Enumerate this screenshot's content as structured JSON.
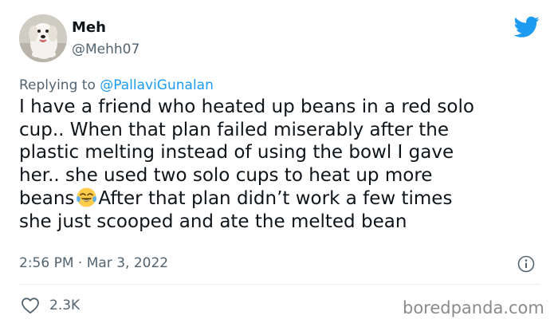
{
  "user": {
    "display_name": "Meh",
    "handle": "@Mehh07",
    "avatar_alt": "white puppy avatar"
  },
  "reply": {
    "prefix": "Replying to ",
    "mention": "@PallaviGunalan"
  },
  "tweet": {
    "lines": [
      "I have a friend who heated up beans in a red solo",
      "cup.. When that plan failed miserably after the",
      "plastic melting instead of using the bowl I gave",
      "her.. she used two solo cups to heat up more",
      "beans",
      "After that plan didn’t work a few times",
      "she just scooped and ate the melted bean"
    ],
    "emoji": "face-with-tears-of-joy"
  },
  "meta": {
    "time": "2:56 PM",
    "separator": " · ",
    "date": "Mar 3, 2022"
  },
  "actions": {
    "like_count": "2.3K"
  },
  "watermark": "boredpanda.com",
  "colors": {
    "twitter_blue": "#1d9bf0",
    "text": "#0f1419",
    "secondary": "#536471",
    "divider": "#e6ecf0",
    "watermark": "#8a8a8a"
  },
  "icons": {
    "brand": "twitter-bird-icon",
    "info": "info-icon",
    "like": "heart-icon"
  }
}
